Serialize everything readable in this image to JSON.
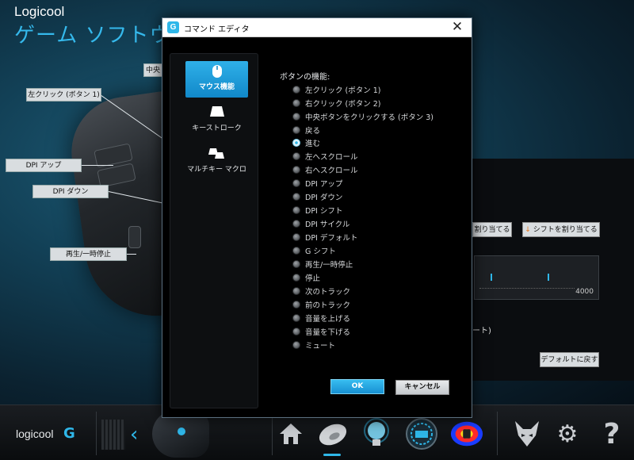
{
  "app": {
    "brand": "Logicool",
    "title": "ゲーム ソフトウェア",
    "callouts": {
      "center": "中央",
      "left_click": "左クリック (ボタン 1)",
      "dpi_up": "DPI アップ",
      "dpi_down": "DPI ダウン",
      "play_pause": "再生/一時停止"
    },
    "right_panel": {
      "assign_btn": "割り当てる",
      "shift_assign_btn": "シフトを割り当てる",
      "slider_max": "4000",
      "partial_text": "ート)",
      "reset_default_btn": "デフォルトに戻す"
    }
  },
  "taskbar": {
    "logo_text": "logicool",
    "logo_g": "G",
    "back_chevron": "‹",
    "icons": [
      "home-icon",
      "mouse-icon",
      "lighting-icon",
      "speedometer-icon",
      "heatmap-icon",
      "wolf-icon",
      "gear-icon",
      "help-icon"
    ],
    "help_glyph": "?",
    "gear_glyph": "⚙"
  },
  "dialog": {
    "title": "コマンド エディタ",
    "g_icon": "G",
    "close_glyph": "✕",
    "nav": [
      {
        "label": "マウス機能",
        "icon": "mouse-icon",
        "active": true
      },
      {
        "label": "キーストローク",
        "icon": "key-icon",
        "active": false
      },
      {
        "label": "マルチキー マクロ",
        "icon": "multikey-icon",
        "active": false
      }
    ],
    "function_heading": "ボタンの機能:",
    "functions": [
      "左クリック (ボタン 1)",
      "右クリック (ボタン 2)",
      "中央ボタンをクリックする (ボタン 3)",
      "戻る",
      "進む",
      "左へスクロール",
      "右へスクロール",
      "DPI アップ",
      "DPI ダウン",
      "DPI シフト",
      "DPI サイクル",
      "DPI デフォルト",
      "G シフト",
      "再生/一時停止",
      "停止",
      "次のトラック",
      "前のトラック",
      "音量を上げる",
      "音量を下げる",
      "ミュート"
    ],
    "selected_function": "進む",
    "ok_label": "OK",
    "cancel_label": "キャンセル"
  },
  "colors": {
    "accent": "#2fb7e9",
    "orange": "#e8781f"
  }
}
